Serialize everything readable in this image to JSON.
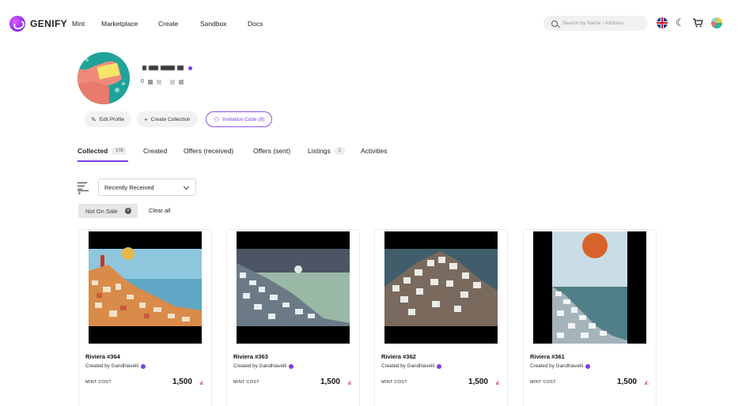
{
  "header": {
    "logo": "GENIFY",
    "nav": [
      "Mint",
      "Marketplace",
      "Create",
      "Sandbox",
      "Docs"
    ],
    "search_placeholder": "Search by Name / Address"
  },
  "profile": {
    "address_prefix": "0"
  },
  "actions": {
    "edit_profile": "Edit Profile",
    "create_collection": "Create Collection",
    "invitation_code": "Invitation Code (8)"
  },
  "tabs": [
    {
      "label": "Collected",
      "count": "178"
    },
    {
      "label": "Created"
    },
    {
      "label": "Offers (received)"
    },
    {
      "label": "Offers (sent)"
    },
    {
      "label": "Listings",
      "count": "1"
    },
    {
      "label": "Activities"
    }
  ],
  "filters": {
    "sort_selected": "Recently Received",
    "chip": "Not On Sale",
    "clear_all": "Clear all"
  },
  "cards": [
    {
      "title": "Riviera #364",
      "creator": "Created by Gandhiavelli",
      "mint_label": "MINT COST",
      "mint_value": "1,500"
    },
    {
      "title": "Riviera #363",
      "creator": "Created by Gandhiavelli",
      "mint_label": "MINT COST",
      "mint_value": "1,500"
    },
    {
      "title": "Riviera #362",
      "creator": "Created by Gandhiavelli",
      "mint_label": "MINT COST",
      "mint_value": "1,500"
    },
    {
      "title": "Riviera #361",
      "creator": "Created by Gandhiavelli",
      "mint_label": "MINT COST",
      "mint_value": "1,500"
    }
  ],
  "colors": {
    "accent": "#7b3fe4",
    "token": "#d9534f"
  },
  "icons": [
    "search-icon",
    "uk-flag-icon",
    "moon-icon",
    "cart-icon",
    "user-avatar-icon",
    "edit-icon",
    "plus-icon",
    "users-icon",
    "filter-icon",
    "chevron-down-icon",
    "close-icon",
    "verified-icon",
    "token-icon"
  ]
}
